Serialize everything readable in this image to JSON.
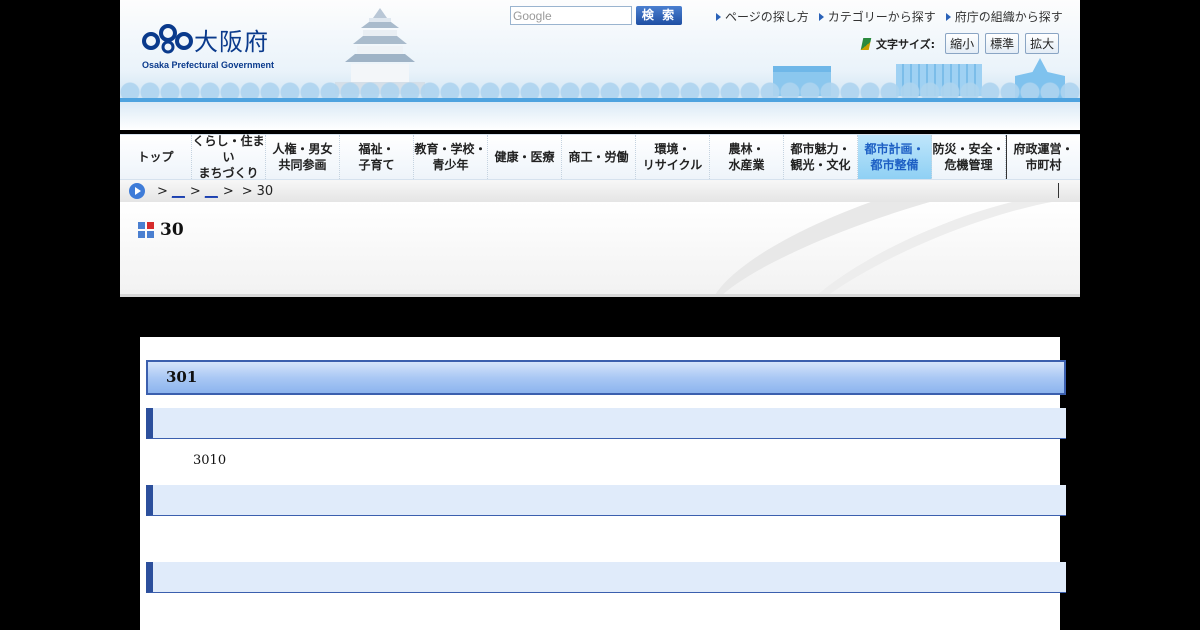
{
  "header": {
    "logo_text": "大阪府",
    "logo_sub": "Osaka Prefectural Government",
    "search_placeholder": "Google",
    "search_button": "検 索",
    "top_links": [
      "ページの探し方",
      "カテゴリーから探す",
      "府庁の組織から探す"
    ],
    "font_size_label": "文字サイズ:",
    "font_size_buttons": [
      "縮小",
      "標準",
      "拡大"
    ]
  },
  "nav": {
    "items": [
      "トップ",
      "くらし・住まい\nまちづくり",
      "人権・男女\n共同参画",
      "福祉・\n子育て",
      "教育・学校・\n青少年",
      "健康・医療",
      "商工・労働",
      "環境・\nリサイクル",
      "農林・\n水産業",
      "都市魅力・\n観光・文化",
      "都市計画・\n都市整備",
      "防災・安全・\n危機管理",
      "府政運営・\n市町村"
    ]
  },
  "breadcrumb": {
    "sep": ">",
    "link1": "__",
    "link2": "__",
    "current": "30"
  },
  "page": {
    "title": "30"
  },
  "content": {
    "h2": "301",
    "para": "3010"
  }
}
